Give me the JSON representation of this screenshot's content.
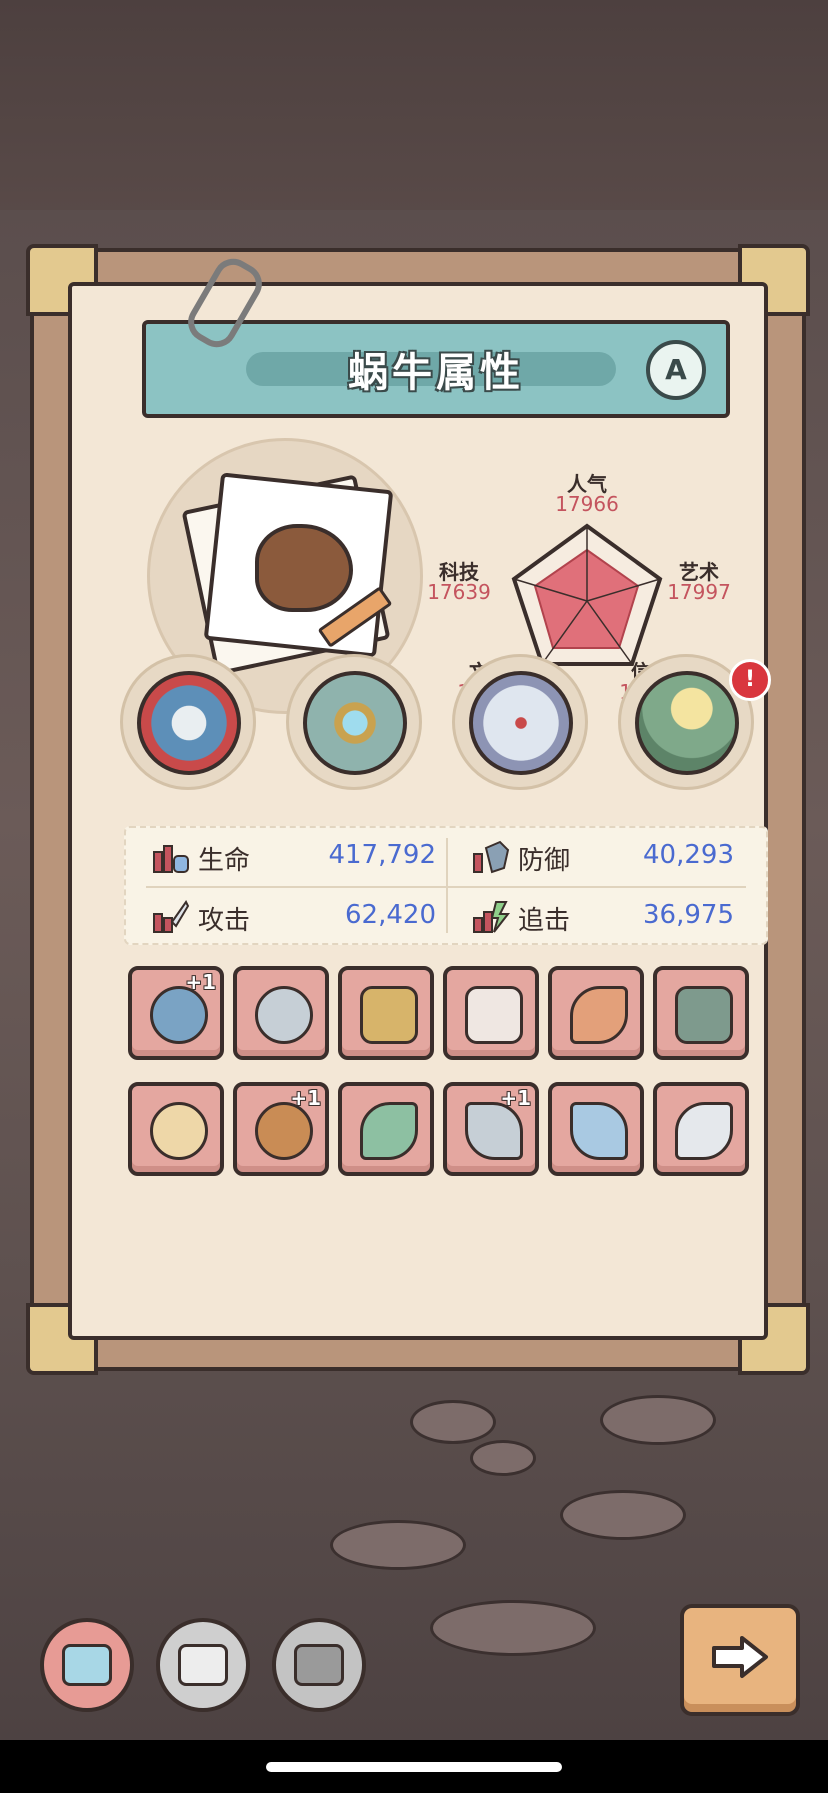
{
  "panel": {
    "title": "蜗牛属性",
    "grade": "A"
  },
  "radar": {
    "popularity": {
      "label": "人气",
      "value": "17966"
    },
    "art": {
      "label": "艺术",
      "value": "17997"
    },
    "belief": {
      "label": "信仰",
      "value": "18293"
    },
    "culture": {
      "label": "文化",
      "value": "18246"
    },
    "tech": {
      "label": "科技",
      "value": "17639"
    }
  },
  "stats": {
    "hp": {
      "label": "生命",
      "value": "417,792"
    },
    "defense": {
      "label": "防御",
      "value": "40,293"
    },
    "attack": {
      "label": "攻击",
      "value": "62,420"
    },
    "chase": {
      "label": "追击",
      "value": "36,975"
    }
  },
  "badges": {
    "alert": "!"
  },
  "equipment": {
    "plus_labels": [
      "+1",
      "+1",
      "+1"
    ]
  },
  "colors": {
    "accent_teal": "#8cc3c3",
    "stat_value": "#4a6ad0",
    "radar_value": "#c4545e",
    "slot_bg": "#e4a7a0"
  }
}
